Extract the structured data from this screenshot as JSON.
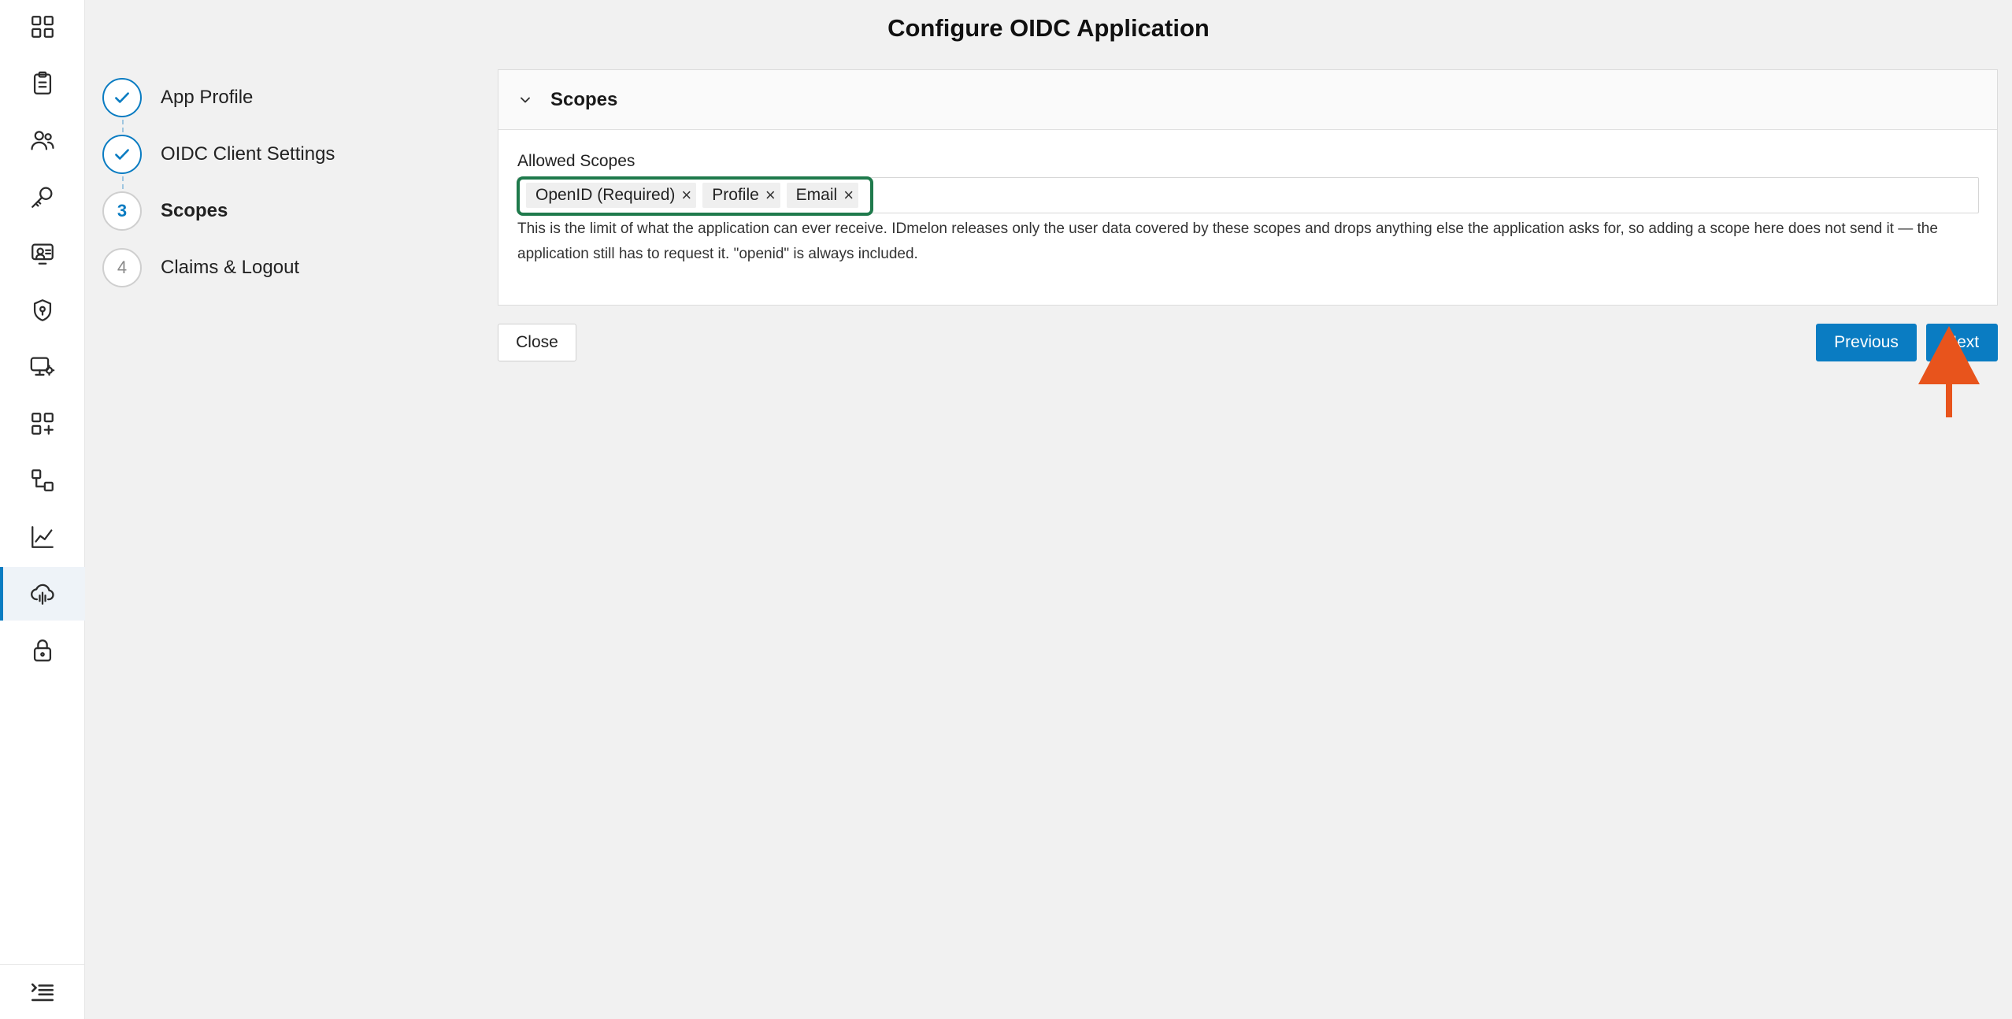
{
  "page": {
    "title": "Configure OIDC Application"
  },
  "sidebar": {
    "items": [
      {
        "icon": "dashboard-icon"
      },
      {
        "icon": "clipboard-icon"
      },
      {
        "icon": "users-icon"
      },
      {
        "icon": "key-icon"
      },
      {
        "icon": "user-monitor-icon"
      },
      {
        "icon": "shield-icon"
      },
      {
        "icon": "monitor-gear-icon"
      },
      {
        "icon": "apps-add-icon"
      },
      {
        "icon": "workflow-icon"
      },
      {
        "icon": "chart-icon"
      },
      {
        "icon": "cloud-fingerprint-icon",
        "active": true
      },
      {
        "icon": "lock-icon"
      }
    ],
    "toggle_icon": "menu-collapse-icon"
  },
  "stepper": {
    "steps": [
      {
        "number": "1",
        "label": "App Profile",
        "state": "done"
      },
      {
        "number": "2",
        "label": "OIDC Client Settings",
        "state": "done"
      },
      {
        "number": "3",
        "label": "Scopes",
        "state": "current"
      },
      {
        "number": "4",
        "label": "Claims & Logout",
        "state": "upcoming"
      }
    ]
  },
  "scopes_panel": {
    "title": "Scopes",
    "field_label": "Allowed Scopes",
    "tags": [
      {
        "label": "OpenID (Required)",
        "remove": "×"
      },
      {
        "label": "Profile",
        "remove": "×"
      },
      {
        "label": "Email",
        "remove": "×"
      }
    ],
    "helper_text": "This is the limit of what the application can ever receive. IDmelon releases only the user data covered by these scopes and drops anything else the application asks for, so adding a scope here does not send it — the application still has to request it. \"openid\" is always included."
  },
  "footer": {
    "close_label": "Close",
    "previous_label": "Previous",
    "next_label": "Next"
  },
  "colors": {
    "accent": "#0a7cc2",
    "highlight_box": "#1f7a4c",
    "annotation_arrow": "#e8541c"
  }
}
